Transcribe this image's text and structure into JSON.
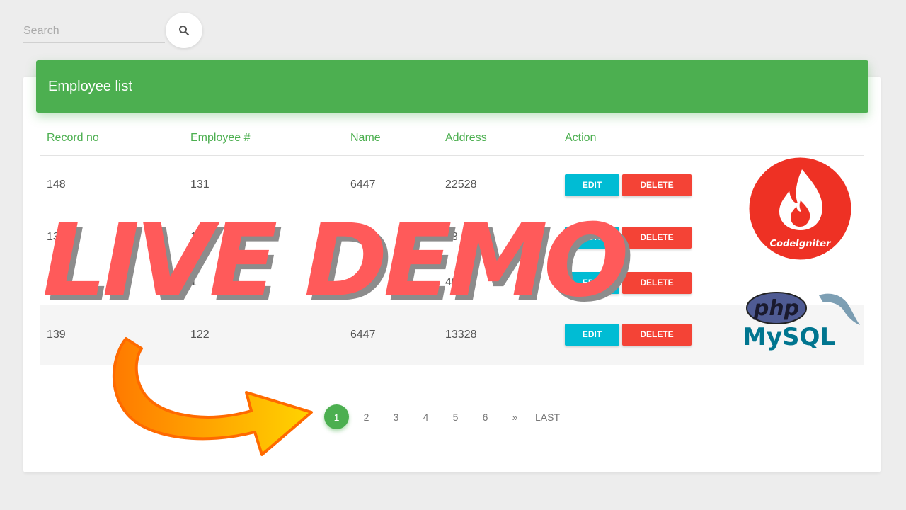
{
  "search": {
    "placeholder": "Search"
  },
  "card": {
    "title": "Employee list"
  },
  "table": {
    "headers": [
      "Record no",
      "Employee #",
      "Name",
      "Address",
      "Action"
    ],
    "rows": [
      {
        "record": "148",
        "employee": "131",
        "name": "6447",
        "address": "22528"
      },
      {
        "record": "13",
        "employee": "13",
        "name": "47",
        "address": "53"
      },
      {
        "record": "1",
        "employee": "1",
        "name": "47",
        "address": "40"
      },
      {
        "record": "139",
        "employee": "122",
        "name": "6447",
        "address": "13328"
      }
    ],
    "edit_label": "EDIT",
    "delete_label": "DELETE"
  },
  "pagination": {
    "pages": [
      "1",
      "2",
      "3",
      "4",
      "5",
      "6"
    ],
    "next": "»",
    "last": "LAST",
    "active": "1"
  },
  "overlay": {
    "banner_text": "LIVE DEMO",
    "codeigniter_text": "CodeIgniter",
    "php_text": "php",
    "mysql_text": "MySQL"
  },
  "colors": {
    "accent_green": "#4caf50",
    "edit_cyan": "#00bcd4",
    "delete_red": "#f44336",
    "banner_red": "#ff5a5a",
    "arrow_orange": "#ff9800"
  },
  "icons": [
    "search-icon",
    "codeigniter-logo",
    "php-mysql-logo",
    "arrow-graphic"
  ]
}
